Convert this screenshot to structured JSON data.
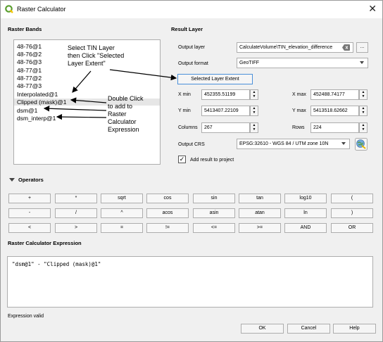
{
  "window": {
    "title": "Raster Calculator",
    "close": "✕"
  },
  "raster_bands": {
    "heading": "Raster Bands",
    "items": [
      "48-76@1",
      "48-76@2",
      "48-76@3",
      "48-77@1",
      "48-77@2",
      "48-77@3",
      "Interpolated@1",
      "Clipped (mask)@1",
      "dsm@1",
      "dsm_interp@1"
    ],
    "selected": "Clipped (mask)@1"
  },
  "annotations": {
    "select_tin": "Select TIN Layer\nthen Click \"Selected\nLayer Extent\"",
    "double_click": "Double Click\nto add to\nRaster\nCalculator\nExpression"
  },
  "result_layer": {
    "heading": "Result Layer",
    "output_layer_label": "Output layer",
    "output_layer_value": "CalculateVolume\\TIN_elevation_difference",
    "browse_label": "...",
    "output_format_label": "Output format",
    "output_format_value": "GeoTIFF",
    "selected_extent_button": "Selected Layer Extent",
    "xmin_label": "X min",
    "xmin_value": "452355.51199",
    "xmax_label": "X max",
    "xmax_value": "452488.74177",
    "ymin_label": "Y min",
    "ymin_value": "5413407.22109",
    "ymax_label": "Y max",
    "ymax_value": "5413518.62662",
    "columns_label": "Columns",
    "columns_value": "267",
    "rows_label": "Rows",
    "rows_value": "224",
    "crs_label": "Output CRS",
    "crs_value": "EPSG:32610 - WGS 84 / UTM zone 10N",
    "add_result_label": "Add result to project",
    "add_result_checked": "✓"
  },
  "operators": {
    "heading": "Operators",
    "rows": [
      [
        "+",
        "*",
        "sqrt",
        "cos",
        "sin",
        "tan",
        "log10",
        "("
      ],
      [
        "-",
        "/",
        "^",
        "acos",
        "asin",
        "atan",
        "ln",
        ")"
      ],
      [
        "<",
        ">",
        "=",
        "!=",
        "<=",
        ">=",
        "AND",
        "OR"
      ]
    ]
  },
  "expression": {
    "heading": "Raster Calculator Expression",
    "value": "\"dsm@1\" - \"Clipped (mask)@1\""
  },
  "status": "Expression valid",
  "buttons": {
    "ok": "OK",
    "cancel": "Cancel",
    "help": "Help"
  },
  "colors": {
    "qgis_green": "#5a9e2f",
    "qgis_yellow": "#f2c400"
  }
}
